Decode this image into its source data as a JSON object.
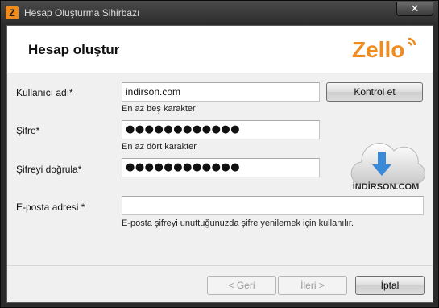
{
  "window": {
    "title": "Hesap Oluşturma Sihirbazı",
    "close_glyph": "✕",
    "app_icon_letter": "Z"
  },
  "header": {
    "title": "Hesap oluştur",
    "logo_text": "Zello"
  },
  "form": {
    "username": {
      "label": "Kullanıcı adı*",
      "value": "indirson.com",
      "hint": "En az beş karakter",
      "check_button": "Kontrol et"
    },
    "password": {
      "label": "Şifre*",
      "value": "●●●●●●●●●●●●",
      "hint": "En az dört karakter"
    },
    "password_confirm": {
      "label": "Şifreyi doğrula*",
      "value": "●●●●●●●●●●●●"
    },
    "email": {
      "label": "E-posta adresi *",
      "value": "",
      "hint": "E-posta şifreyi unuttuğunuzda şifre yenilemek için kullanılır."
    }
  },
  "watermark": {
    "text": "İNDİRSON.COM"
  },
  "footer": {
    "back": "< Geri",
    "next": "İleri >",
    "cancel": "İptal"
  },
  "colors": {
    "zello_orange": "#f08c1e",
    "window_dark": "#2b2b2b"
  }
}
